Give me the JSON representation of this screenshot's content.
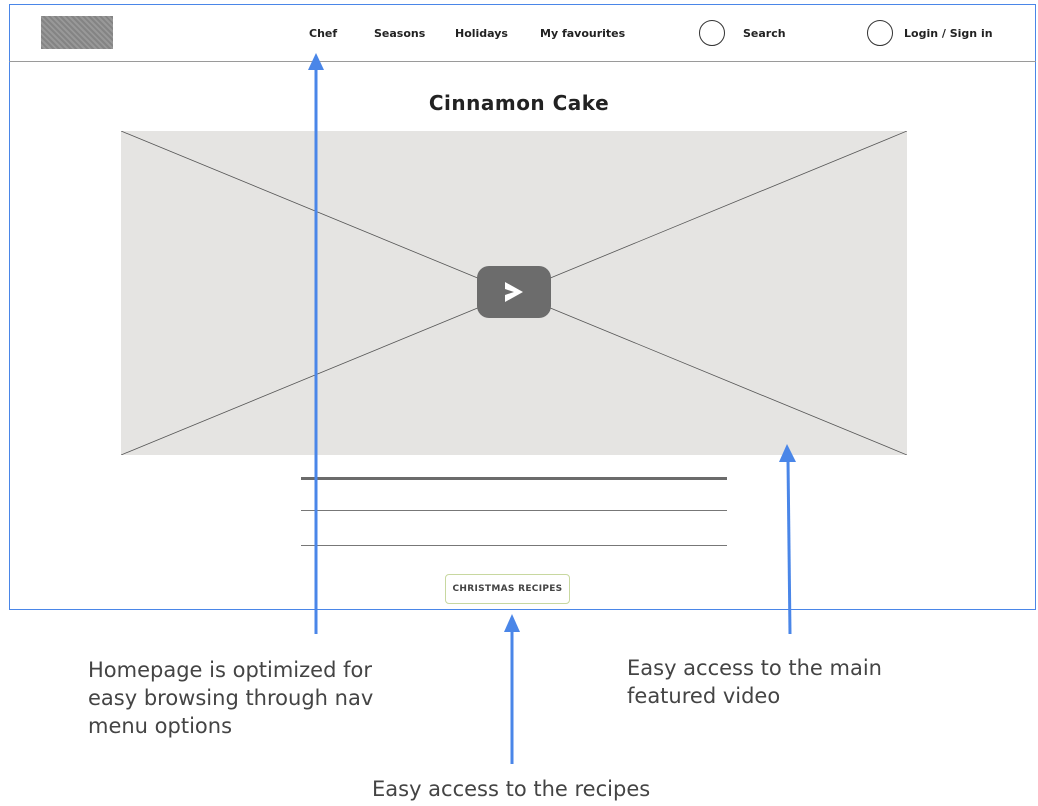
{
  "nav": {
    "items": [
      "Chef",
      "Seasons",
      "Holidays",
      "My favourites"
    ],
    "search_label": "Search",
    "login_label": "Login / Sign in"
  },
  "main": {
    "title": "Cinnamon Cake",
    "tag_label": "CHRISTMAS RECIPES"
  },
  "annotations": {
    "nav_note": "Homepage is optimized for easy browsing through nav menu options",
    "video_note": "Easy access to the main featured video",
    "recipes_note": "Easy access to the recipes"
  },
  "colors": {
    "annotation_arrow": "#4a86e8",
    "frame_border": "#4a86e8",
    "video_placeholder": "#e5e4e2",
    "play_button": "#6c6c6c",
    "tag_border": "#c8d8a0"
  }
}
